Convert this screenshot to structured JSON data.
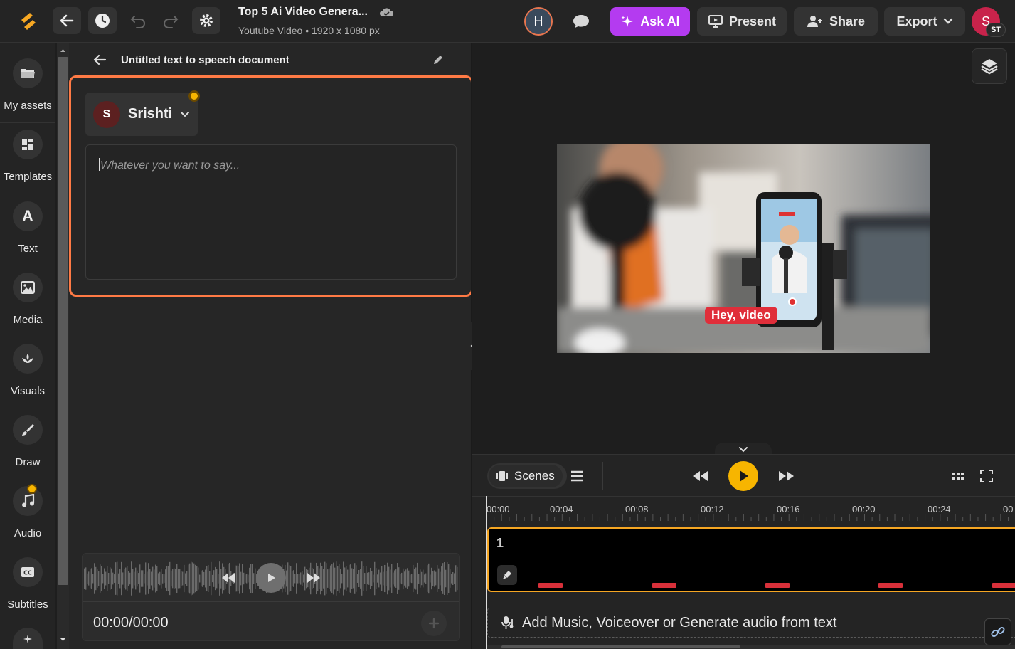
{
  "topbar": {
    "title": "Top 5 Ai Video Genera...",
    "subtitle": "Youtube Video • 1920 x 1080 px",
    "collab_initial": "H",
    "ask_ai_label": "Ask AI",
    "present_label": "Present",
    "share_label": "Share",
    "export_label": "Export",
    "user_initial": "S",
    "user_badge": "ST"
  },
  "sidebar": {
    "items": [
      {
        "label": "My assets",
        "icon": "folder-icon"
      },
      {
        "label": "Templates",
        "icon": "templates-icon"
      },
      {
        "label": "Text",
        "icon": "text-icon"
      },
      {
        "label": "Media",
        "icon": "image-icon"
      },
      {
        "label": "Visuals",
        "icon": "visuals-icon"
      },
      {
        "label": "Draw",
        "icon": "brush-icon"
      },
      {
        "label": "Audio",
        "icon": "music-icon"
      },
      {
        "label": "Subtitles",
        "icon": "cc-icon"
      }
    ]
  },
  "panel": {
    "header_title": "Untitled text to speech document",
    "voice_initial": "S",
    "voice_name": "Srishti",
    "textarea_placeholder": "Whatever you want to say...",
    "player_time": "00:00/00:00"
  },
  "preview": {
    "caption": "Hey, video"
  },
  "timeline": {
    "scenes_label": "Scenes",
    "ruler": [
      "00:00",
      "00:04",
      "00:08",
      "00:12",
      "00:16",
      "00:20",
      "00:24",
      "00"
    ],
    "scene_number": "1",
    "audio_prompt": "Add Music, Voiceover or Generate audio from text"
  },
  "colors": {
    "accent_orange": "#ff7a45",
    "ask_ai_purple": "#b43bf0",
    "play_yellow": "#f7b500",
    "avatar_red": "#c8234b"
  }
}
